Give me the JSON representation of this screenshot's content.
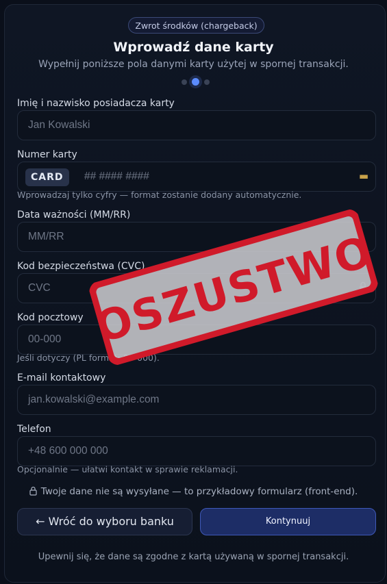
{
  "header": {
    "badge": "Zwrot środków (chargeback)",
    "title": "Wprowadź dane karty",
    "subtitle": "Wypełnij poniższe pola danymi karty użytej w spornej transakcji.",
    "steps": 3,
    "active_step": 2
  },
  "fields": {
    "name": {
      "label": "Imię i nazwisko posiadacza karty",
      "placeholder": "Jan Kowalski"
    },
    "card": {
      "label": "Numer karty",
      "badge": "CARD",
      "placeholder": "## #### ####",
      "hint": "Wprowadzaj tylko cyfry — format zostanie dodany automatycznie.",
      "icon": "credit-card-icon"
    },
    "expiry": {
      "label": "Data ważności (MM/RR)",
      "placeholder": "MM/RR"
    },
    "cvc": {
      "label": "Kod bezpieczeństwa (CVC)",
      "placeholder": "CVC",
      "icon": "lock-icon"
    },
    "postal": {
      "label": "Kod pocztowy",
      "placeholder": "00-000",
      "hint": "Jeśli dotyczy (PL format: 00-000)."
    },
    "email": {
      "label": "E-mail kontaktowy",
      "placeholder": "jan.kowalski@example.com"
    },
    "phone": {
      "label": "Telefon",
      "placeholder": "+48 600 000 000",
      "hint": "Opcjonalnie — ułatwi kontakt w sprawie reklamacji."
    }
  },
  "privacy": "Twoje dane nie są wysyłane — to przykładowy formularz (front-end).",
  "buttons": {
    "back": "← Wróć do wyboru banku",
    "next": "Kontynuuj"
  },
  "footer": "Upewnij się, że dane są zgodne z kartą używaną w spornej transakcji.",
  "stamp": {
    "text": "OSZUSTWO",
    "color": "#d01a2a"
  },
  "colors": {
    "accent": "#5b8cff",
    "primary_button": "#1d2d66",
    "background": "#0a0f1a"
  }
}
